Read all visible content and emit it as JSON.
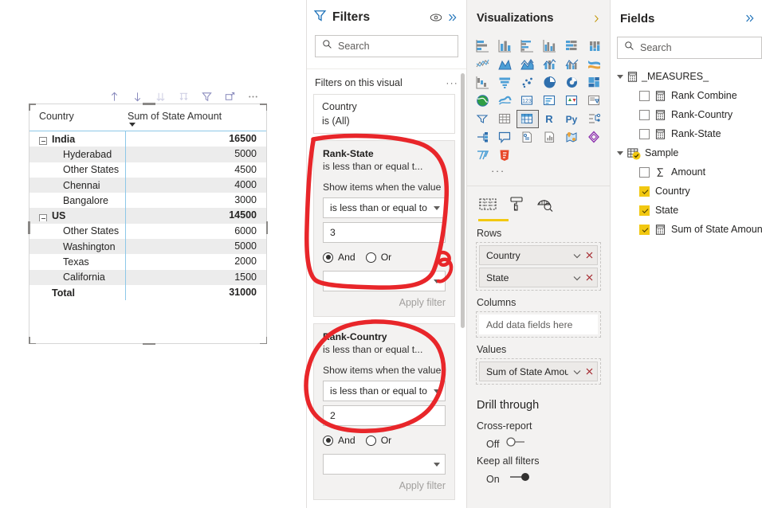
{
  "canvas": {
    "toolbar": {
      "buttons": [
        {
          "name": "drill-up-icon",
          "title": "Drill up",
          "enabled": true
        },
        {
          "name": "drill-down-icon",
          "title": "Drill down",
          "enabled": true
        },
        {
          "name": "expand-all-icon",
          "title": "Expand all down one level in the hierarchy",
          "enabled": false
        },
        {
          "name": "go-to-next-level-icon",
          "title": "Go to the next level in the hierarchy",
          "enabled": false
        },
        {
          "name": "filter-icon",
          "title": "Filters",
          "enabled": true
        },
        {
          "name": "focus-mode-icon",
          "title": "Focus mode",
          "enabled": true
        },
        {
          "name": "more-options-icon",
          "title": "More options",
          "enabled": true
        }
      ]
    },
    "matrix": {
      "columns": [
        "Country",
        "Sum of State Amount"
      ],
      "sorted_column": "Sum of State Amount",
      "sort_direction": "descending",
      "rows": [
        {
          "label": "India",
          "value": "16500",
          "level": 0,
          "expandable": true,
          "band": false
        },
        {
          "label": "Hyderabad",
          "value": "5000",
          "level": 1,
          "expandable": false,
          "band": true
        },
        {
          "label": "Other States",
          "value": "4500",
          "level": 1,
          "expandable": false,
          "band": false
        },
        {
          "label": "Chennai",
          "value": "4000",
          "level": 1,
          "expandable": false,
          "band": true
        },
        {
          "label": "Bangalore",
          "value": "3000",
          "level": 1,
          "expandable": false,
          "band": false
        },
        {
          "label": "US",
          "value": "14500",
          "level": 0,
          "expandable": true,
          "band": true
        },
        {
          "label": "Other States",
          "value": "6000",
          "level": 1,
          "expandable": false,
          "band": false
        },
        {
          "label": "Washington",
          "value": "5000",
          "level": 1,
          "expandable": false,
          "band": true
        },
        {
          "label": "Texas",
          "value": "2000",
          "level": 1,
          "expandable": false,
          "band": false
        },
        {
          "label": "California",
          "value": "1500",
          "level": 1,
          "expandable": false,
          "band": true
        }
      ],
      "total": {
        "label": "Total",
        "value": "31000"
      }
    }
  },
  "filters": {
    "title": "Filters",
    "search_placeholder": "Search",
    "section_label": "Filters on this visual",
    "cards": [
      {
        "field": "Country",
        "summary": "is (All)",
        "expanded": false
      },
      {
        "field": "Rank-State",
        "summary": "is less than or equal t...",
        "expanded": true,
        "prompt": "Show items when the value",
        "condition": "is less than or equal to",
        "value": "3",
        "conjunction": "And",
        "conjunction_options": [
          "And",
          "Or"
        ],
        "second_condition": "",
        "apply_label": "Apply filter"
      },
      {
        "field": "Rank-Country",
        "summary": "is less than or equal t...",
        "expanded": true,
        "prompt": "Show items when the value",
        "condition": "is less than or equal to",
        "value": "2",
        "conjunction": "And",
        "conjunction_options": [
          "And",
          "Or"
        ],
        "second_condition": "",
        "apply_label": "Apply filter"
      }
    ]
  },
  "visualizations": {
    "title": "Visualizations",
    "icons": [
      "stacked-bar-chart-icon",
      "stacked-column-chart-icon",
      "clustered-bar-chart-icon",
      "clustered-column-chart-icon",
      "100-stacked-bar-chart-icon",
      "100-stacked-column-chart-icon",
      "line-chart-icon",
      "area-chart-icon",
      "stacked-area-chart-icon",
      "line-stacked-column-chart-icon",
      "line-clustered-column-chart-icon",
      "ribbon-chart-icon",
      "waterfall-chart-icon",
      "funnel-chart-icon",
      "scatter-chart-icon",
      "pie-chart-icon",
      "donut-chart-icon",
      "treemap-icon",
      "map-icon",
      "filled-map-icon",
      "gauge-icon",
      "card-icon",
      "multi-row-card-icon",
      "kpi-icon",
      "slicer-icon",
      "table-icon",
      "matrix-icon",
      "r-script-visual-icon",
      "python-visual-icon",
      "decomposition-tree-icon",
      "key-influencers-icon",
      "q-and-a-icon",
      "paginated-report-icon",
      "smart-narrative-icon",
      "arcgis-map-icon",
      "power-apps-icon",
      "power-automate-icon",
      "html-viewer-icon"
    ],
    "selected_icon": "matrix-icon",
    "more_icon": "more-visuals-icon",
    "tabs": [
      {
        "name": "fields-tab",
        "active": true
      },
      {
        "name": "format-tab",
        "active": false
      },
      {
        "name": "analytics-tab",
        "active": false
      }
    ],
    "wells": [
      {
        "label": "Rows",
        "pills": [
          {
            "name": "Country"
          },
          {
            "name": "State"
          }
        ]
      },
      {
        "label": "Columns",
        "placeholder": "Add data fields here",
        "pills": []
      },
      {
        "label": "Values",
        "pills": [
          {
            "name": "Sum of State Amount"
          }
        ]
      }
    ],
    "drill_through": {
      "title": "Drill through",
      "cross_report": {
        "label": "Cross-report",
        "state": "Off",
        "on": false
      },
      "keep_all_filters": {
        "label": "Keep all filters",
        "state": "On",
        "on": true
      }
    }
  },
  "fields": {
    "title": "Fields",
    "search_placeholder": "Search",
    "tree": [
      {
        "group": "_MEASURES_",
        "icon": "measure-table-icon",
        "expanded": true,
        "items": [
          {
            "label": "Rank Combine",
            "checked": false,
            "icon": "measure-icon"
          },
          {
            "label": "Rank-Country",
            "checked": false,
            "icon": "measure-icon"
          },
          {
            "label": "Rank-State",
            "checked": false,
            "icon": "measure-icon"
          }
        ]
      },
      {
        "group": "Sample",
        "icon": "table-icon",
        "expanded": true,
        "items": [
          {
            "label": "Amount",
            "checked": false,
            "icon": "sigma-icon"
          },
          {
            "label": "Country",
            "checked": true,
            "icon": ""
          },
          {
            "label": "State",
            "checked": true,
            "icon": ""
          },
          {
            "label": "Sum of State Amount",
            "checked": true,
            "icon": "measure-icon"
          }
        ]
      }
    ]
  },
  "annotations": {
    "color": "#e8262a",
    "shapes": [
      "oval-around-rank-state-card",
      "oval-around-rank-country-card",
      "small-squiggle"
    ]
  }
}
